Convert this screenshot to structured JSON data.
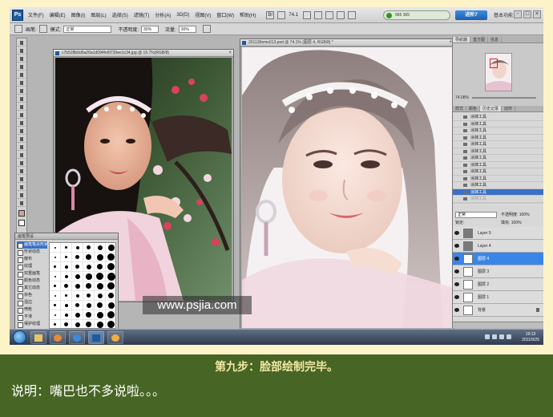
{
  "menubar": {
    "items": [
      "文件(F)",
      "编辑(E)",
      "图像(I)",
      "图层(L)",
      "选择(S)",
      "滤镜(T)",
      "分析(A)",
      "3D(D)",
      "视图(V)",
      "窗口(W)",
      "帮助(H)"
    ],
    "zoom": "74.1",
    "status_pill": "965  365",
    "badge": "进阶7",
    "workspace": "基本功能"
  },
  "options": {
    "brush_label": "画笔:",
    "mode_label": "模式:",
    "mode_value": "正常",
    "opacity_label": "不透明度:",
    "opacity_value": "30%",
    "flow_label": "流量:",
    "flow_value": "30%"
  },
  "doc1": {
    "title": "c7b528b0d0a26a1d094fe6f730ee1c34.jpg @ 16.7%(RGB/8)"
  },
  "doc2": {
    "title": "201139emo013.psd @ 74.1% (图层 4, RGB/8) *"
  },
  "brush_panel": {
    "title": "画笔预设",
    "options": [
      "画笔笔尖形状",
      "形状动态",
      "散布",
      "纹理",
      "双重画笔",
      "颜色动态",
      "其它动态",
      "杂色",
      "湿边",
      "喷枪",
      "平滑",
      "保护纹理"
    ]
  },
  "watermark": "www.psjia.com",
  "navigator": {
    "tabs": [
      "导航器",
      "直方图",
      "信息"
    ],
    "zoom": "74.08%"
  },
  "history": {
    "tabs": [
      "样式",
      "颜色",
      "历史记录",
      "动作"
    ],
    "items": [
      "涂抹工具",
      "涂抹工具",
      "涂抹工具",
      "涂抹工具",
      "涂抹工具",
      "涂抹工具",
      "涂抹工具",
      "涂抹工具",
      "涂抹工具",
      "涂抹工具",
      "涂抹工具",
      "涂抹工具"
    ],
    "dim_item": "涂抹工具"
  },
  "layers": {
    "mode": "正常",
    "opacity": "不透明度: 100%",
    "lock": "锁定:",
    "fill": "填充: 100%",
    "rows": [
      {
        "name": "Layer 5",
        "gray": true
      },
      {
        "name": "Layer 4",
        "gray": true
      },
      {
        "name": "图层 4",
        "gray": false
      },
      {
        "name": "图层 3",
        "gray": false
      },
      {
        "name": "图层 2",
        "gray": false
      },
      {
        "name": "图层 1",
        "gray": false
      },
      {
        "name": "背景",
        "gray": false
      }
    ]
  },
  "taskbar": {
    "time": "19:13",
    "date": "2011/9/25"
  },
  "caption": {
    "title": "第九步：脸部绘制完毕。",
    "description": "说明：嘴巴也不多说啦。。。"
  }
}
